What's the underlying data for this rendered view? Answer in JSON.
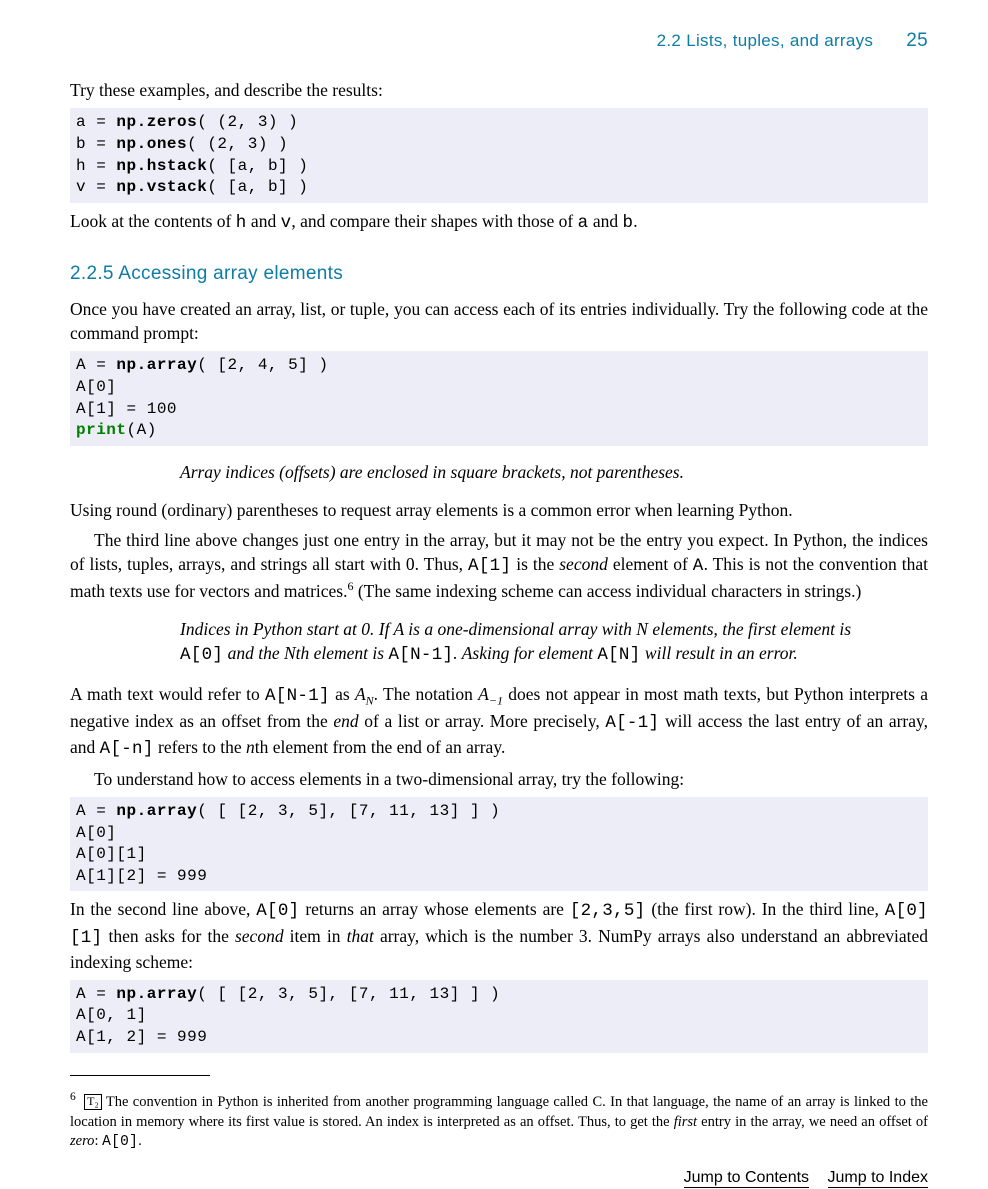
{
  "header": {
    "section": "2.2   Lists, tuples, and arrays",
    "page": "25"
  },
  "p1": "Try these examples, and describe the results:",
  "code1_l1a": "a = ",
  "code1_l1b": "np.zeros",
  "code1_l1c": "( (2, 3) )",
  "code1_l2a": "b = ",
  "code1_l2b": "np.ones",
  "code1_l2c": "( (2, 3) )",
  "code1_l3a": "h = ",
  "code1_l3b": "np.hstack",
  "code1_l3c": "( [a, b] )",
  "code1_l4a": "v = ",
  "code1_l4b": "np.vstack",
  "code1_l4c": "( [a, b] )",
  "p2a": "Look at the contents of ",
  "p2b": "h",
  "p2c": " and ",
  "p2d": "v",
  "p2e": ", and compare their shapes with those of ",
  "p2f": "a",
  "p2g": " and ",
  "p2h": "b",
  "p2i": ".",
  "subsection": "2.2.5  Accessing array elements",
  "p3": "Once you have created an array, list, or tuple, you can access each of its entries individually. Try the following code at the command prompt:",
  "code2_l1a": "A = ",
  "code2_l1b": "np.array",
  "code2_l1c": "( [2, 4, 5] )",
  "code2_l2": "A[0]",
  "code2_l3": "A[1] = 100",
  "code2_l4a": "print",
  "code2_l4b": "(A)",
  "callout1": "Array indices (offsets) are enclosed in square brackets, not parentheses.",
  "p4": "Using round (ordinary) parentheses to request array elements is a common error when learning Python.",
  "p5a": "The third line above changes just one entry in the array, but it may not be the entry you expect. In Python, the indices of lists, tuples, arrays, and strings all start with 0. Thus, ",
  "p5b": "A[1]",
  "p5c": " is the ",
  "p5d": "second",
  "p5e": " element of ",
  "p5f": "A",
  "p5g": ". This is not the convention that math texts use for vectors and matrices.",
  "p5h": "6",
  "p5i": " (The same indexing scheme can access individual characters in strings.)",
  "callout2a": "Indices in Python start at 0. If A is a one-dimensional array with N elements, the first element is ",
  "callout2b": "A[0]",
  "callout2c": " and the Nth element is ",
  "callout2d": "A[N-1]",
  "callout2e": ". Asking for element ",
  "callout2f": "A[N]",
  "callout2g": " will result in an error.",
  "p6a": "A math text would refer to ",
  "p6b": "A[N-1]",
  "p6c": " as ",
  "p6d": "A",
  "p6d2": "N",
  "p6e": ". The notation ",
  "p6f": "A",
  "p6f2": "−1",
  "p6g": " does not appear in most math texts, but Python interprets a negative index as an offset from the ",
  "p6h": "end",
  "p6i": " of a list or array. More precisely, ",
  "p6j": "A[-1]",
  "p6k": " will access the last entry of an array, and ",
  "p6l": "A[-n]",
  "p6m": " refers to the ",
  "p6n": "n",
  "p6o": "th element from the end of an array.",
  "p7": "To understand how to access elements in a two-dimensional array, try the following:",
  "code3_l1a": "A = ",
  "code3_l1b": "np.array",
  "code3_l1c": "( [ [2, 3, 5], [7, 11, 13] ] )",
  "code3_l2": "A[0]",
  "code3_l3": "A[0][1]",
  "code3_l4": "A[1][2] = 999",
  "p8a": "In the second line above, ",
  "p8b": "A[0]",
  "p8c": " returns an array whose elements are ",
  "p8d": "[2,3,5]",
  "p8e": " (the first row). In the third line, ",
  "p8f": "A[0][1]",
  "p8g": " then asks for the ",
  "p8h": "second",
  "p8i": " item in ",
  "p8j": "that",
  "p8k": " array, which is the number 3. NumPy arrays also understand an abbreviated indexing scheme:",
  "code4_l1a": "A = ",
  "code4_l1b": "np.array",
  "code4_l1c": "( [ [2, 3, 5], [7, 11, 13] ] )",
  "code4_l2": "A[0, 1]",
  "code4_l3": "A[1, 2] = 999",
  "footnote": {
    "num": "6",
    "t2": "T₂",
    "a": "The convention in Python is inherited from another programming language called C. In that language, the name of an array is linked to the location in memory where its first value is stored. An index is interpreted as an offset. Thus, to get the ",
    "b": "first",
    "c": " entry in the array, we need an offset of ",
    "d": "zero",
    "e": ": ",
    "f": "A[0]",
    "g": "."
  },
  "links": {
    "contents": "Jump to Contents",
    "index": "Jump to Index"
  }
}
